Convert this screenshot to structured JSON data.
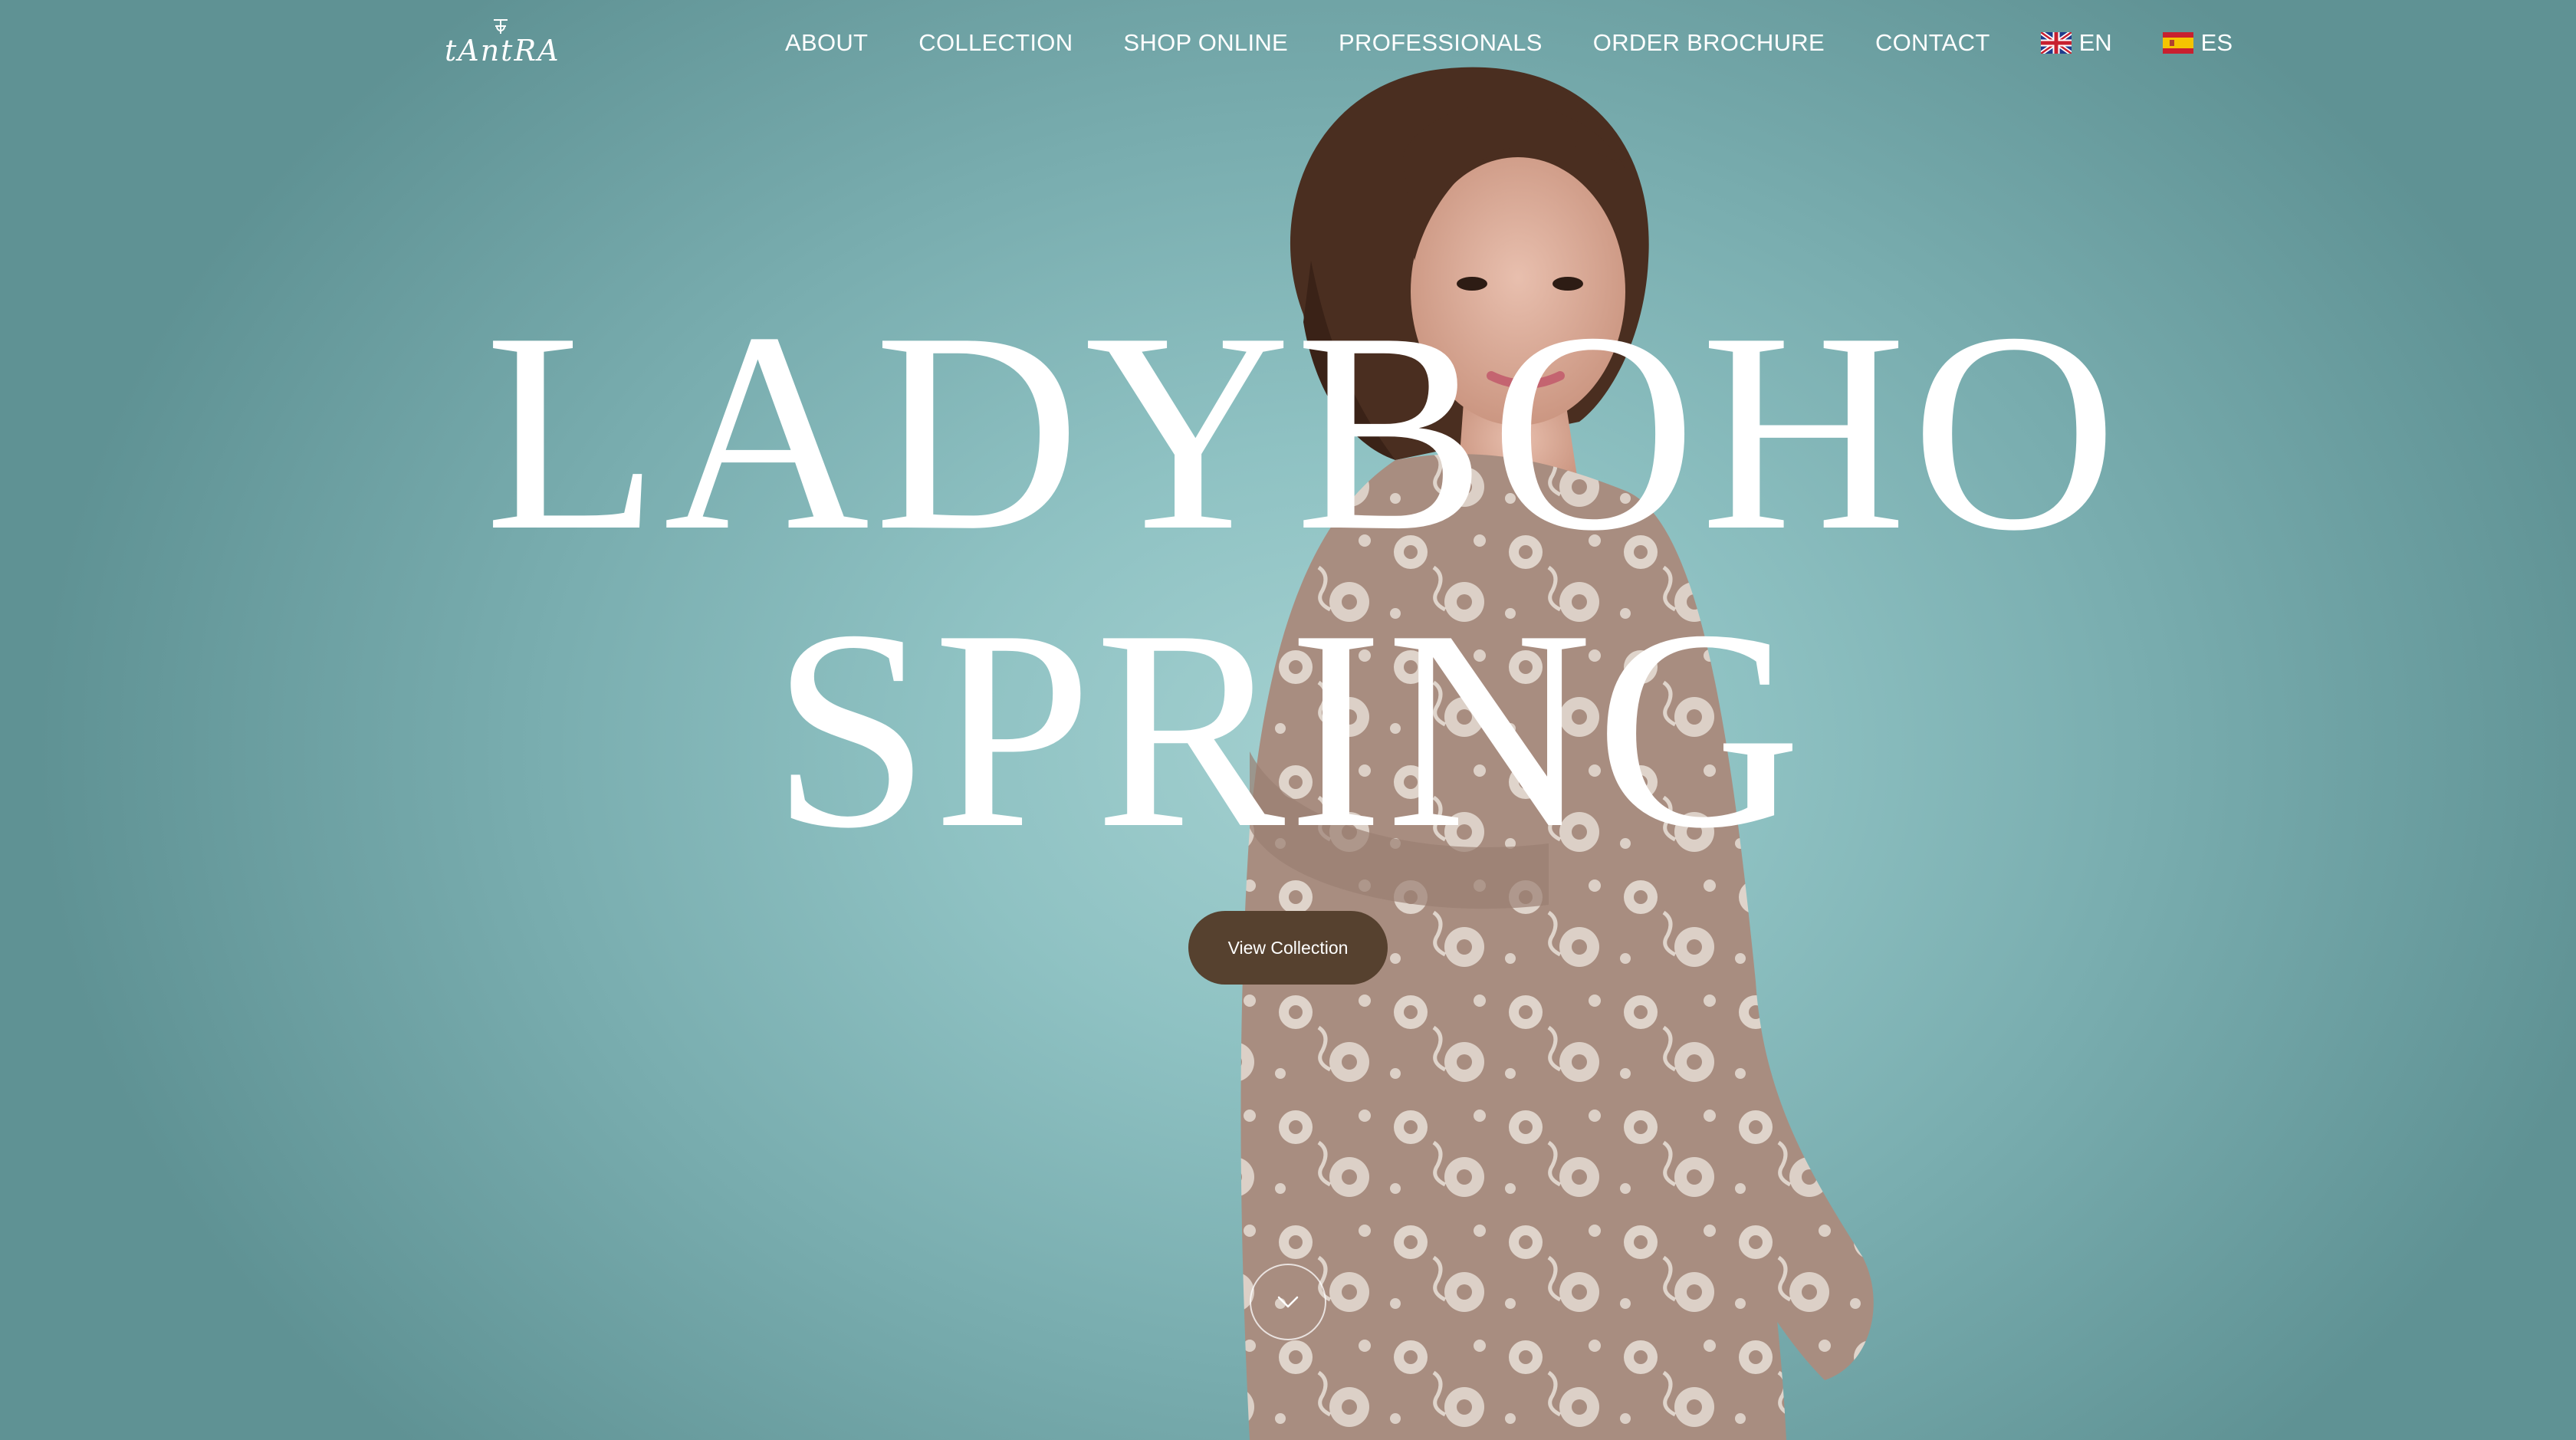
{
  "brand": {
    "logo_text": "tAntRA"
  },
  "nav": {
    "items": [
      {
        "label": "ABOUT"
      },
      {
        "label": "COLLECTION"
      },
      {
        "label": "SHOP ONLINE"
      },
      {
        "label": "PROFESSIONALS"
      },
      {
        "label": "ORDER BROCHURE"
      },
      {
        "label": "CONTACT"
      }
    ],
    "languages": [
      {
        "code": "EN",
        "flag": "uk-flag-icon"
      },
      {
        "code": "ES",
        "flag": "spain-flag-icon"
      }
    ]
  },
  "hero": {
    "title_line1": "LADYBOHO",
    "title_line2": "SPRING",
    "cta_label": "View Collection",
    "scroll_icon": "chevron-down-icon"
  },
  "colors": {
    "background_center": "#a3d0d0",
    "background_edge": "#5f9294",
    "cta_background": "#56412f",
    "text": "#ffffff",
    "dress": "#a88d80",
    "embroidery": "#e9e1d8",
    "hair": "#4a2e20"
  }
}
